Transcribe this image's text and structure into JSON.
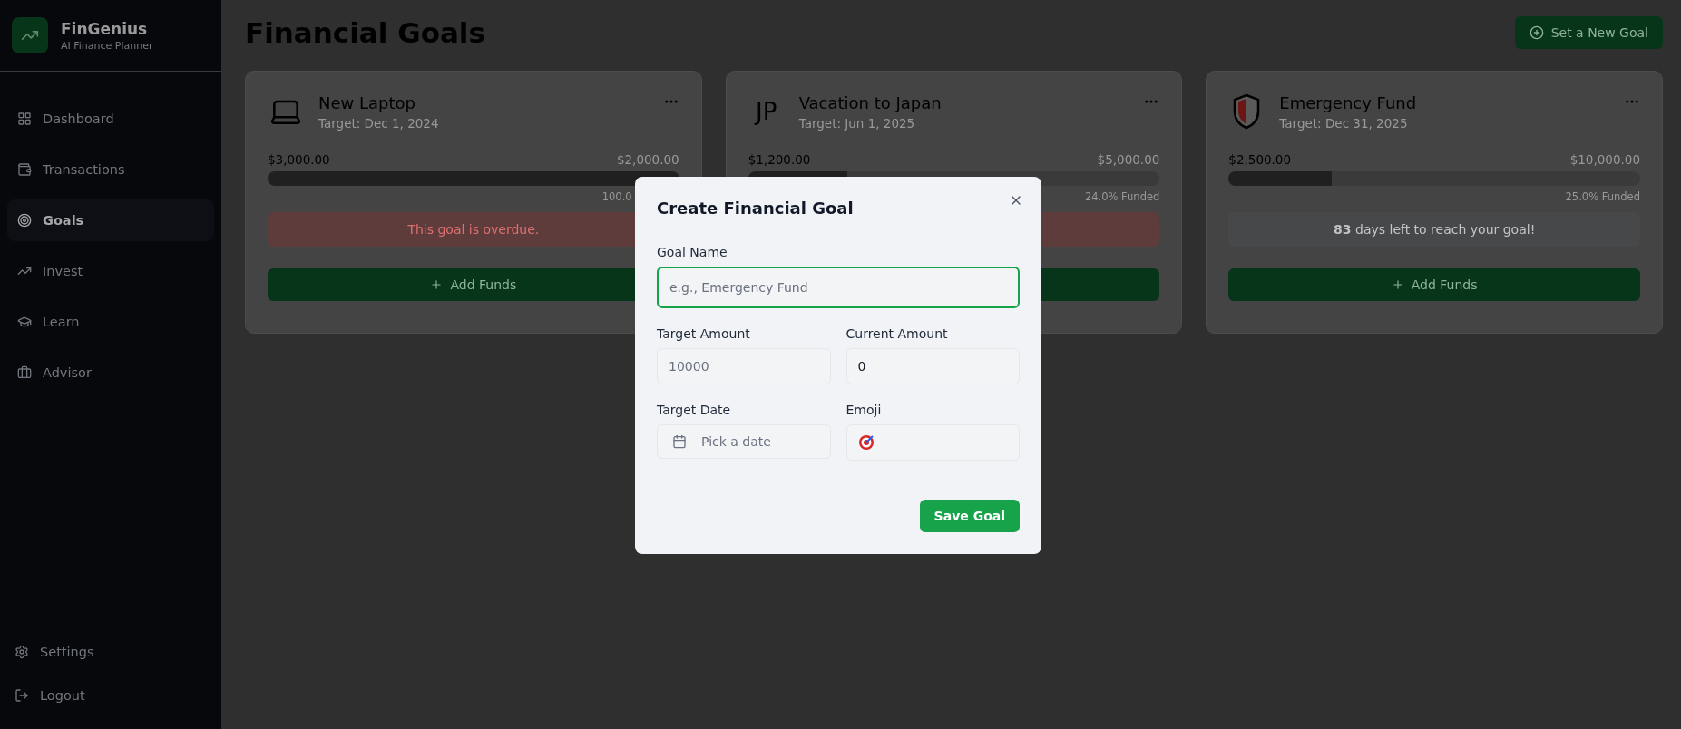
{
  "sidebar": {
    "brand": "FinGenius",
    "tagline": "AI Finance Planner",
    "items": [
      {
        "label": "Dashboard",
        "selected": false
      },
      {
        "label": "Transactions",
        "selected": false
      },
      {
        "label": "Goals",
        "selected": true
      },
      {
        "label": "Invest",
        "selected": false
      },
      {
        "label": "Learn",
        "selected": false
      },
      {
        "label": "Advisor",
        "selected": false
      }
    ],
    "footer": [
      {
        "label": "Settings"
      },
      {
        "label": "Logout"
      }
    ]
  },
  "header": {
    "title": "Financial Goals",
    "action": "Set a New Goal"
  },
  "goals": [
    {
      "title": "New Laptop",
      "target": "Target: Dec 1, 2024",
      "current": "$3,000.00",
      "goal": "$2,000.00",
      "level": 1,
      "funded": "100.0",
      "overdue": true,
      "message": "This goal is overdue.",
      "button": "Add Funds"
    },
    {
      "emoji": "JP",
      "title": "Vacation to Japan",
      "target": "Target: Jun 1, 2025",
      "current": "$1,200.00",
      "goal": "$5,000.00",
      "level": 0.24,
      "funded": "24.0% Funded",
      "overdue": true
    },
    {
      "title": "Emergency Fund",
      "target": "Target: Dec 31, 2025",
      "current": "$2,500.00",
      "goal": "$10,000.00",
      "level": 0.25,
      "funded": "25.0% Funded",
      "overdue": false,
      "message": "**83** days left to reach your goal!",
      "button": "Add Funds"
    }
  ],
  "dialog": {
    "title": "Create Financial Goal",
    "fields": [
      {
        "label": "Goal Name",
        "placeholder": "e.g., Emergency Fund",
        "focused": true
      },
      {
        "label": "Target Amount",
        "placeholder": "10000"
      },
      {
        "label": "Current Amount",
        "value": "0"
      },
      {
        "label": "Target Date",
        "placeholder": "Pick a date",
        "kind": "date"
      },
      {
        "label": "Emoji",
        "kind": "emoji"
      }
    ],
    "submit": "Save Goal"
  }
}
